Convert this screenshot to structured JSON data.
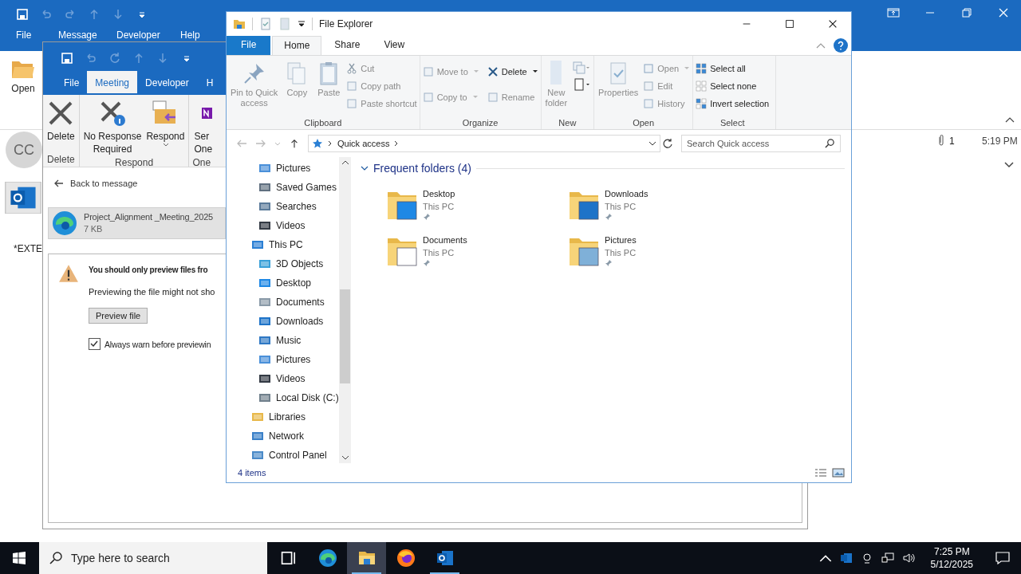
{
  "outlook_main": {
    "tabs": [
      {
        "label": "File",
        "selected": false
      },
      {
        "label": "Message",
        "selected": false
      },
      {
        "label": "Developer",
        "selected": false
      },
      {
        "label": "Help",
        "selected": false
      }
    ],
    "open_button": "Open",
    "avatar": "CC",
    "body_text": "*EXTE",
    "attachment_count": "1",
    "time": "5:19 PM"
  },
  "meeting_window": {
    "tabs": [
      {
        "label": "File",
        "selected": false
      },
      {
        "label": "Meeting",
        "selected": true
      },
      {
        "label": "Developer",
        "selected": false
      },
      {
        "label": "H",
        "selected": false
      }
    ],
    "ribbon_groups": [
      {
        "label": "Delete",
        "buttons": [
          {
            "kind": "delete",
            "lines": [
              "Delete"
            ],
            "dropdown": false
          }
        ]
      },
      {
        "label": "Respond",
        "buttons": [
          {
            "kind": "no-response",
            "lines": [
              "No Response",
              "Required"
            ],
            "dropdown": false
          },
          {
            "kind": "respond",
            "lines": [
              "Respond"
            ],
            "dropdown": true
          }
        ]
      },
      {
        "label": "One",
        "buttons": [
          {
            "kind": "onenote",
            "lines": [
              "Ser",
              "One"
            ],
            "dropdown": false
          }
        ]
      }
    ],
    "back_link": "Back to message",
    "attachment": {
      "name": "Project_Alignment _Meeting_2025",
      "size": "7 KB"
    },
    "warning": {
      "title": "You should only preview files fro",
      "text": "Previewing the file might not sho",
      "button": "Preview file",
      "checkbox": {
        "label": "Always warn before previewin",
        "checked": true
      }
    }
  },
  "explorer": {
    "title": "File Explorer",
    "tabs": [
      {
        "label": "File",
        "selected": false
      },
      {
        "label": "Home",
        "selected": true
      },
      {
        "label": "Share",
        "selected": false
      },
      {
        "label": "View",
        "selected": false
      }
    ],
    "ribbon": {
      "clipboard": {
        "label": "Clipboard",
        "large": [
          {
            "kind": "pin",
            "lines": [
              "Pin to Quick",
              "access"
            ],
            "disabled": true
          },
          {
            "kind": "copy",
            "lines": [
              "Copy"
            ],
            "disabled": true
          },
          {
            "kind": "paste",
            "lines": [
              "Paste"
            ],
            "disabled": true
          }
        ],
        "small": [
          {
            "kind": "cut",
            "label": "Cut",
            "disabled": true
          },
          {
            "kind": "copy-path",
            "label": "Copy path",
            "disabled": true
          },
          {
            "kind": "paste-shortcut",
            "label": "Paste shortcut",
            "disabled": true
          }
        ]
      },
      "organize": {
        "label": "Organize",
        "items": [
          {
            "kind": "move",
            "label": "Move to",
            "dropdown": true,
            "disabled": true
          },
          {
            "kind": "delete",
            "label": "Delete",
            "dropdown": true,
            "disabled": false
          },
          {
            "kind": "copy-to",
            "label": "Copy to",
            "dropdown": true,
            "disabled": true
          },
          {
            "kind": "rename",
            "label": "Rename",
            "dropdown": false,
            "disabled": true
          }
        ]
      },
      "new": {
        "label": "New",
        "button": {
          "lines": [
            "New",
            "folder"
          ],
          "disabled": true
        }
      },
      "open": {
        "label": "Open",
        "button": {
          "lines": [
            "Properties"
          ],
          "disabled": true
        },
        "small": [
          {
            "kind": "open",
            "label": "Open",
            "dropdown": true,
            "disabled": true
          },
          {
            "kind": "edit",
            "label": "Edit",
            "dropdown": false,
            "disabled": true
          },
          {
            "kind": "history",
            "label": "History",
            "dropdown": false,
            "disabled": true
          }
        ]
      },
      "select": {
        "label": "Select",
        "items": [
          {
            "kind": "select-all",
            "label": "Select all",
            "disabled": false
          },
          {
            "kind": "select-none",
            "label": "Select none",
            "disabled": false
          },
          {
            "kind": "invert",
            "label": "Invert selection",
            "disabled": false
          }
        ]
      }
    },
    "address": "Quick access",
    "search_placeholder": "Search Quick access",
    "nav": [
      {
        "kind": "pictures",
        "label": "Pictures"
      },
      {
        "kind": "games",
        "label": "Saved Games"
      },
      {
        "kind": "search",
        "label": "Searches"
      },
      {
        "kind": "videos",
        "label": "Videos"
      },
      {
        "kind": "pc",
        "label": "This PC",
        "children": [
          {
            "kind": "objects",
            "label": "3D Objects"
          },
          {
            "kind": "desktop",
            "label": "Desktop"
          },
          {
            "kind": "documents",
            "label": "Documents"
          },
          {
            "kind": "downloads",
            "label": "Downloads"
          },
          {
            "kind": "music",
            "label": "Music"
          },
          {
            "kind": "pictures",
            "label": "Pictures"
          },
          {
            "kind": "videos",
            "label": "Videos"
          },
          {
            "kind": "disk",
            "label": "Local Disk (C:)"
          }
        ]
      },
      {
        "kind": "libraries",
        "label": "Libraries"
      },
      {
        "kind": "network",
        "label": "Network"
      },
      {
        "kind": "control",
        "label": "Control Panel"
      }
    ],
    "section_title": "Frequent folders (4)",
    "folders": [
      {
        "kind": "desktop",
        "name": "Desktop",
        "location": "This PC"
      },
      {
        "kind": "downloads",
        "name": "Downloads",
        "location": "This PC"
      },
      {
        "kind": "documents",
        "name": "Documents",
        "location": "This PC"
      },
      {
        "kind": "pictures",
        "name": "Pictures",
        "location": "This PC"
      }
    ],
    "status": "4 items"
  },
  "taskbar": {
    "search_placeholder": "Type here to search",
    "apps": [
      {
        "kind": "task-view",
        "selected": false
      },
      {
        "kind": "edge",
        "selected": false
      },
      {
        "kind": "explorer",
        "selected": true
      },
      {
        "kind": "firefox",
        "selected": false
      },
      {
        "kind": "outlook",
        "selected": false
      }
    ],
    "time": "7:25 PM",
    "date": "5/12/2025"
  }
}
